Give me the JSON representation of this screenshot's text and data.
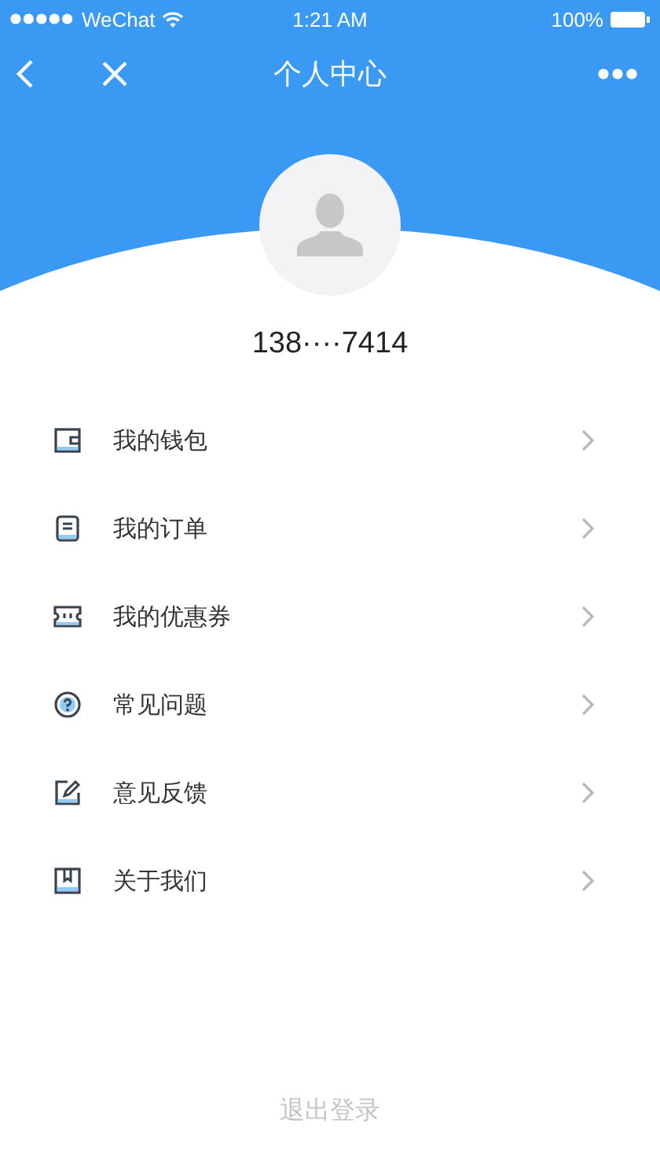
{
  "status_bar": {
    "carrier": "WeChat",
    "time": "1:21 AM",
    "battery": "100%"
  },
  "nav": {
    "title": "个人中心"
  },
  "profile": {
    "phone": "138····7414"
  },
  "menu": [
    {
      "kind": "wallet",
      "label": "我的钱包"
    },
    {
      "kind": "order",
      "label": "我的订单"
    },
    {
      "kind": "coupon",
      "label": "我的优惠券"
    },
    {
      "kind": "help",
      "label": "常见问题"
    },
    {
      "kind": "feedback",
      "label": "意见反馈"
    },
    {
      "kind": "about",
      "label": "关于我们"
    }
  ],
  "logout": "退出登录"
}
